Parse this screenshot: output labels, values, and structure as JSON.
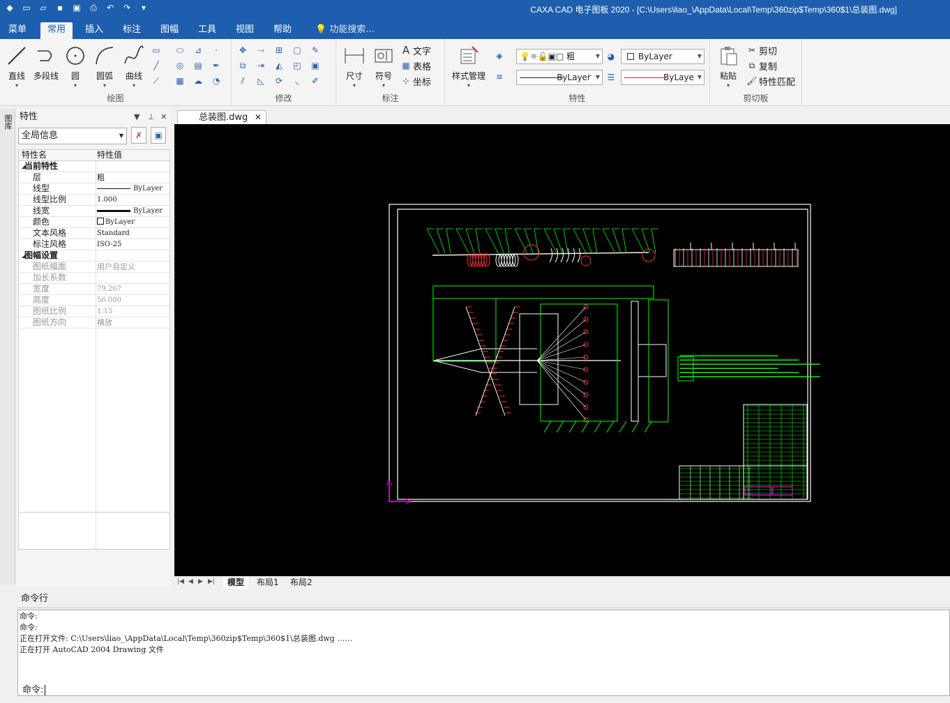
{
  "window": {
    "title": "CAXA CAD 电子图板 2020 - [C:\\Users\\liao_\\AppData\\Local\\Temp\\360zip$Temp\\360$1\\总装图.dwg]"
  },
  "menu": {
    "tabs": [
      "菜单",
      "常用",
      "插入",
      "标注",
      "图幅",
      "工具",
      "视图",
      "帮助"
    ],
    "active": "常用",
    "search_placeholder": "功能搜索..."
  },
  "ribbon": {
    "draw": {
      "label": "绘图",
      "line": "直线",
      "polyline": "多段线",
      "circle": "圆",
      "arc": "圆弧",
      "curve": "曲线"
    },
    "modify": {
      "label": "修改"
    },
    "annotate": {
      "label": "标注",
      "dimension": "尺寸",
      "symbol": "符号",
      "text": "文字",
      "table": "表格",
      "coord": "坐标"
    },
    "properties": {
      "label": "特性",
      "style_mgr": "样式管理",
      "layer": "粗",
      "color": "ByLayer",
      "linetype": "ByLayer",
      "linewidth": "ByLaye"
    },
    "clipboard": {
      "label": "剪切板",
      "paste": "粘贴",
      "cut": "剪切",
      "copy": "复制",
      "match": "特性匹配"
    }
  },
  "left_strip": {
    "label": "图库"
  },
  "property_panel": {
    "title": "特性",
    "selector": "全局信息",
    "col_name": "特性名",
    "col_value": "特性值",
    "group1": "当前特性",
    "rows1": [
      {
        "k": "层",
        "v": "粗"
      },
      {
        "k": "线型",
        "v": "ByLayer"
      },
      {
        "k": "线型比例",
        "v": "1.000"
      },
      {
        "k": "线宽",
        "v": "ByLayer"
      },
      {
        "k": "颜色",
        "v": "ByLayer"
      },
      {
        "k": "文本风格",
        "v": "Standard"
      },
      {
        "k": "标注风格",
        "v": "ISO-25"
      }
    ],
    "group2": "图幅设置",
    "rows2": [
      {
        "k": "图纸幅面",
        "v": "用户自定义"
      },
      {
        "k": "加长系数",
        "v": ""
      },
      {
        "k": "宽度",
        "v": "79.267"
      },
      {
        "k": "高度",
        "v": "56.000"
      },
      {
        "k": "图纸比例",
        "v": "1:15"
      },
      {
        "k": "图纸方向",
        "v": "横放"
      }
    ]
  },
  "document": {
    "tab": "总装图.dwg",
    "layout_tabs": [
      "模型",
      "布局1",
      "布局2"
    ],
    "active_layout": "模型"
  },
  "command": {
    "header": "命令行",
    "lines": [
      "命令:",
      "命令:",
      "正在打开文件: C:\\Users\\liao_\\AppData\\Local\\Temp\\360zip$Temp\\360$1\\总装图.dwg ……",
      "正在打开 AutoCAD 2004 Drawing 文件"
    ],
    "prompt": "命令:"
  },
  "colors": {
    "accent": "#1d5fae",
    "canvas": "#000000",
    "drawing_green": "#00ff00",
    "drawing_white": "#ffffff",
    "drawing_red": "#ff3030",
    "ucs": "#ff00ff"
  }
}
